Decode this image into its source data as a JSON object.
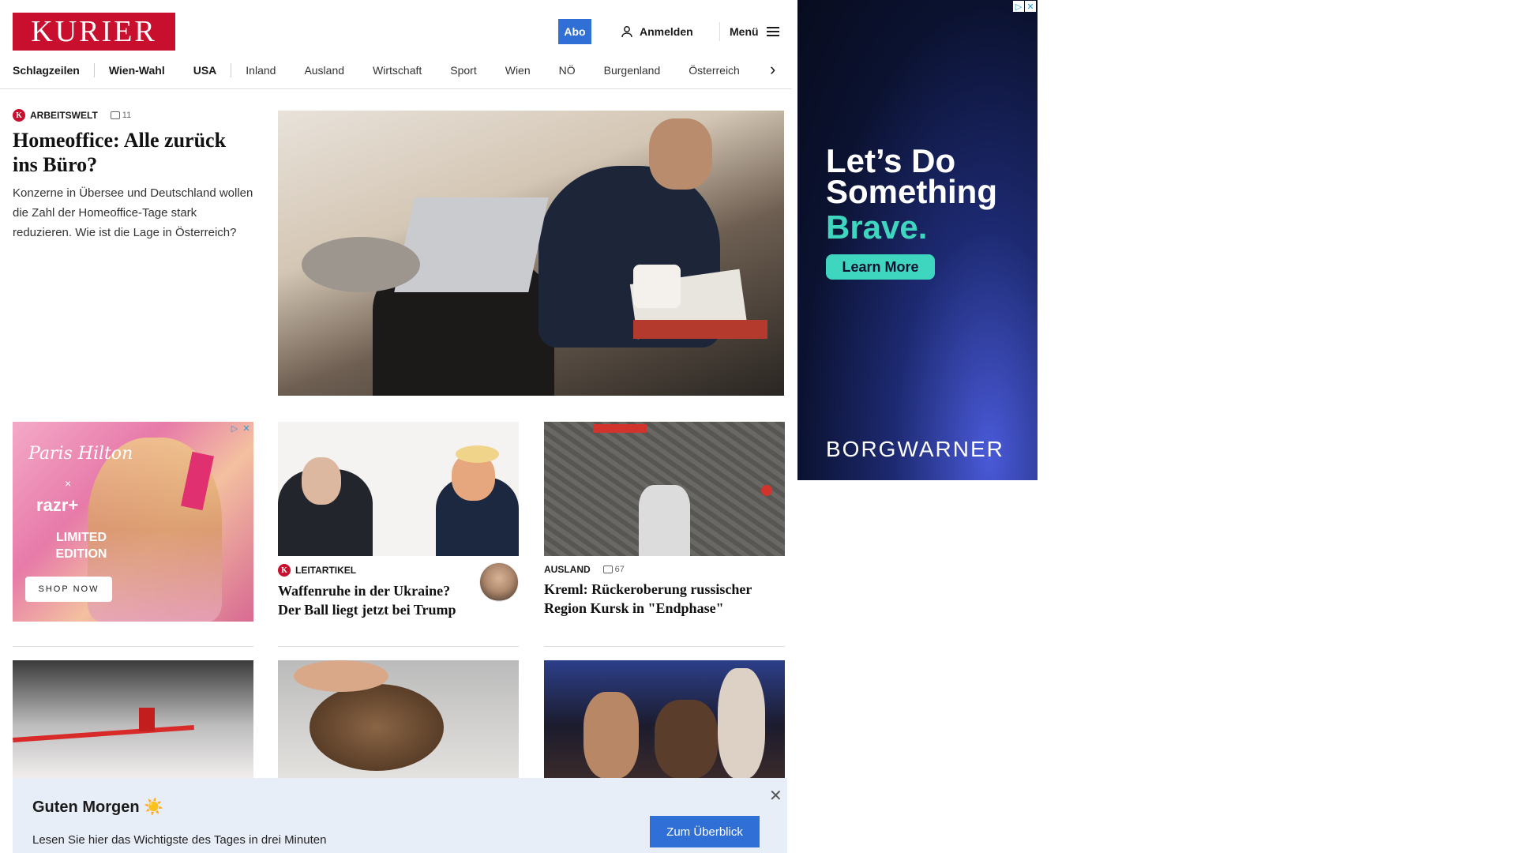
{
  "header": {
    "logo": "KURIER",
    "abo_label": "Abo",
    "login_label": "Anmelden",
    "menu_label": "Menü"
  },
  "nav": {
    "items": [
      "Schlagzeilen",
      "Wien-Wahl",
      "USA",
      "Inland",
      "Ausland",
      "Wirtschaft",
      "Sport",
      "Wien",
      "NÖ",
      "Burgenland",
      "Österreich"
    ]
  },
  "lead": {
    "kicker": "ARBEITSWELT",
    "comments": "11",
    "headline": "Homeoffice: Alle zurück ins Büro?",
    "teaser": "Konzerne in Übersee und Deutschland wollen die Zahl der Homeoffice-Tage stark reduzieren. Wie ist die Lage in Österreich?"
  },
  "side_ad": {
    "line1": "Let’s Do",
    "line2": "Something",
    "line3": "Brave.",
    "button": "Learn More",
    "brand": "BORGWARNER"
  },
  "small_ad": {
    "script": "Paris Hilton",
    "x": "×",
    "brand": "razr+",
    "limited": "LIMITED EDITION",
    "button": "SHOP NOW"
  },
  "cards": [
    {
      "kicker": "LEITARTIKEL",
      "headline": "Waffenruhe in der Ukraine? Der Ball liegt jetzt bei Trump"
    },
    {
      "kicker": "AUSLAND",
      "comments": "67",
      "headline": "Kreml: Rückeroberung russischer Region Kursk in \"Endphase\""
    }
  ],
  "notice": {
    "title": "Guten Morgen",
    "sun": "☀️",
    "text": "Lesen Sie hier das Wichtigste des Tages in drei Minuten",
    "button": "Zum Überblick",
    "close": "✕"
  }
}
